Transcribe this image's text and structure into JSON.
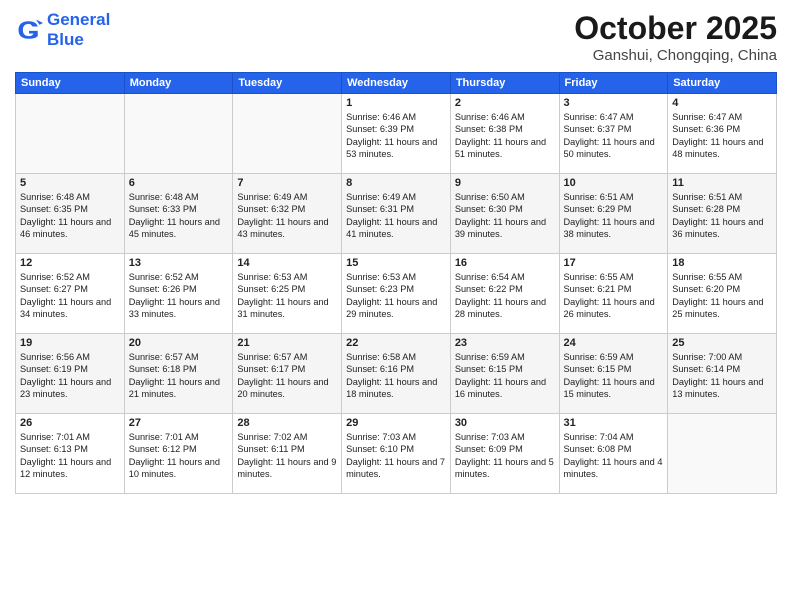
{
  "header": {
    "logo_line1": "General",
    "logo_line2": "Blue",
    "month": "October 2025",
    "location": "Ganshui, Chongqing, China"
  },
  "weekdays": [
    "Sunday",
    "Monday",
    "Tuesday",
    "Wednesday",
    "Thursday",
    "Friday",
    "Saturday"
  ],
  "weeks": [
    [
      {
        "day": "",
        "info": ""
      },
      {
        "day": "",
        "info": ""
      },
      {
        "day": "",
        "info": ""
      },
      {
        "day": "1",
        "info": "Sunrise: 6:46 AM\nSunset: 6:39 PM\nDaylight: 11 hours and 53 minutes."
      },
      {
        "day": "2",
        "info": "Sunrise: 6:46 AM\nSunset: 6:38 PM\nDaylight: 11 hours and 51 minutes."
      },
      {
        "day": "3",
        "info": "Sunrise: 6:47 AM\nSunset: 6:37 PM\nDaylight: 11 hours and 50 minutes."
      },
      {
        "day": "4",
        "info": "Sunrise: 6:47 AM\nSunset: 6:36 PM\nDaylight: 11 hours and 48 minutes."
      }
    ],
    [
      {
        "day": "5",
        "info": "Sunrise: 6:48 AM\nSunset: 6:35 PM\nDaylight: 11 hours and 46 minutes."
      },
      {
        "day": "6",
        "info": "Sunrise: 6:48 AM\nSunset: 6:33 PM\nDaylight: 11 hours and 45 minutes."
      },
      {
        "day": "7",
        "info": "Sunrise: 6:49 AM\nSunset: 6:32 PM\nDaylight: 11 hours and 43 minutes."
      },
      {
        "day": "8",
        "info": "Sunrise: 6:49 AM\nSunset: 6:31 PM\nDaylight: 11 hours and 41 minutes."
      },
      {
        "day": "9",
        "info": "Sunrise: 6:50 AM\nSunset: 6:30 PM\nDaylight: 11 hours and 39 minutes."
      },
      {
        "day": "10",
        "info": "Sunrise: 6:51 AM\nSunset: 6:29 PM\nDaylight: 11 hours and 38 minutes."
      },
      {
        "day": "11",
        "info": "Sunrise: 6:51 AM\nSunset: 6:28 PM\nDaylight: 11 hours and 36 minutes."
      }
    ],
    [
      {
        "day": "12",
        "info": "Sunrise: 6:52 AM\nSunset: 6:27 PM\nDaylight: 11 hours and 34 minutes."
      },
      {
        "day": "13",
        "info": "Sunrise: 6:52 AM\nSunset: 6:26 PM\nDaylight: 11 hours and 33 minutes."
      },
      {
        "day": "14",
        "info": "Sunrise: 6:53 AM\nSunset: 6:25 PM\nDaylight: 11 hours and 31 minutes."
      },
      {
        "day": "15",
        "info": "Sunrise: 6:53 AM\nSunset: 6:23 PM\nDaylight: 11 hours and 29 minutes."
      },
      {
        "day": "16",
        "info": "Sunrise: 6:54 AM\nSunset: 6:22 PM\nDaylight: 11 hours and 28 minutes."
      },
      {
        "day": "17",
        "info": "Sunrise: 6:55 AM\nSunset: 6:21 PM\nDaylight: 11 hours and 26 minutes."
      },
      {
        "day": "18",
        "info": "Sunrise: 6:55 AM\nSunset: 6:20 PM\nDaylight: 11 hours and 25 minutes."
      }
    ],
    [
      {
        "day": "19",
        "info": "Sunrise: 6:56 AM\nSunset: 6:19 PM\nDaylight: 11 hours and 23 minutes."
      },
      {
        "day": "20",
        "info": "Sunrise: 6:57 AM\nSunset: 6:18 PM\nDaylight: 11 hours and 21 minutes."
      },
      {
        "day": "21",
        "info": "Sunrise: 6:57 AM\nSunset: 6:17 PM\nDaylight: 11 hours and 20 minutes."
      },
      {
        "day": "22",
        "info": "Sunrise: 6:58 AM\nSunset: 6:16 PM\nDaylight: 11 hours and 18 minutes."
      },
      {
        "day": "23",
        "info": "Sunrise: 6:59 AM\nSunset: 6:15 PM\nDaylight: 11 hours and 16 minutes."
      },
      {
        "day": "24",
        "info": "Sunrise: 6:59 AM\nSunset: 6:15 PM\nDaylight: 11 hours and 15 minutes."
      },
      {
        "day": "25",
        "info": "Sunrise: 7:00 AM\nSunset: 6:14 PM\nDaylight: 11 hours and 13 minutes."
      }
    ],
    [
      {
        "day": "26",
        "info": "Sunrise: 7:01 AM\nSunset: 6:13 PM\nDaylight: 11 hours and 12 minutes."
      },
      {
        "day": "27",
        "info": "Sunrise: 7:01 AM\nSunset: 6:12 PM\nDaylight: 11 hours and 10 minutes."
      },
      {
        "day": "28",
        "info": "Sunrise: 7:02 AM\nSunset: 6:11 PM\nDaylight: 11 hours and 9 minutes."
      },
      {
        "day": "29",
        "info": "Sunrise: 7:03 AM\nSunset: 6:10 PM\nDaylight: 11 hours and 7 minutes."
      },
      {
        "day": "30",
        "info": "Sunrise: 7:03 AM\nSunset: 6:09 PM\nDaylight: 11 hours and 5 minutes."
      },
      {
        "day": "31",
        "info": "Sunrise: 7:04 AM\nSunset: 6:08 PM\nDaylight: 11 hours and 4 minutes."
      },
      {
        "day": "",
        "info": ""
      }
    ]
  ]
}
